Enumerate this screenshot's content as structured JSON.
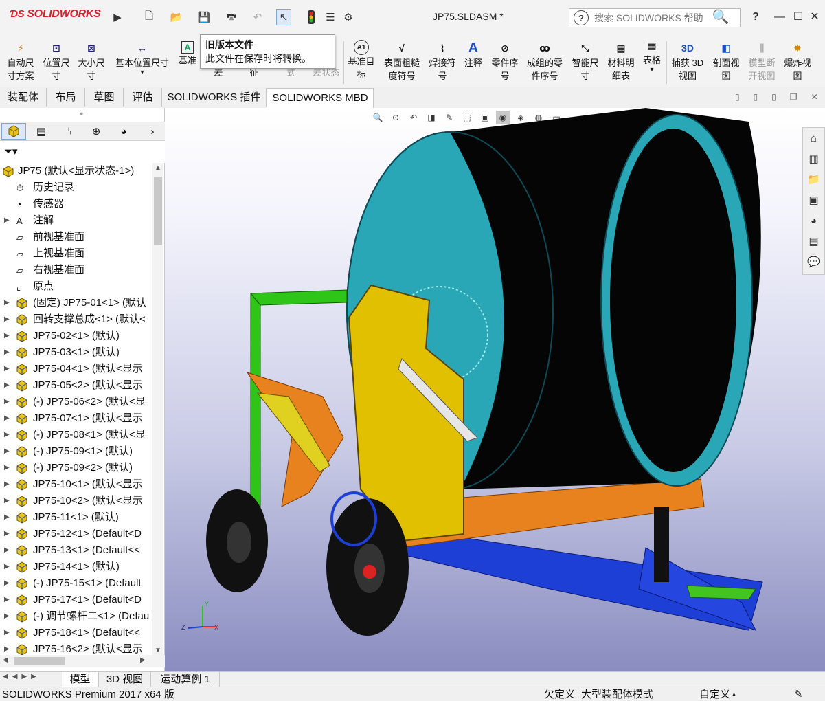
{
  "app": {
    "logo": "SOLIDWORKS",
    "document_title": "JP75.SLDASM *"
  },
  "search": {
    "placeholder": "搜索 SOLIDWORKS 帮助"
  },
  "tooltip": {
    "title": "旧版本文件",
    "text": "此文件在保存时将转换。"
  },
  "ribbon": {
    "items": [
      {
        "label": "自动尺\n寸方案"
      },
      {
        "label": "位置尺\n寸"
      },
      {
        "label": "大小尺\n寸"
      },
      {
        "label": "基本位置尺寸"
      },
      {
        "label": "基准"
      },
      {
        "label": "差"
      },
      {
        "label": "征"
      },
      {
        "label": "式"
      },
      {
        "label": "差状态"
      },
      {
        "label": "基准目\n标"
      },
      {
        "label": "表面粗糙\n度符号"
      },
      {
        "label": "焊接符\n号"
      },
      {
        "label": "注释"
      },
      {
        "label": "零件序\n号"
      },
      {
        "label": "成组的零\n件序号"
      },
      {
        "label": "智能尺\n寸"
      },
      {
        "label": "材料明\n细表"
      },
      {
        "label": "表格"
      },
      {
        "label": "捕获 3D\n视图"
      },
      {
        "label": "剖面视\n图"
      },
      {
        "label": "模型断\n开视图"
      },
      {
        "label": "爆炸视\n图"
      }
    ]
  },
  "command_tabs": [
    "装配体",
    "布局",
    "草图",
    "评估",
    "SOLIDWORKS 插件",
    "SOLIDWORKS MBD"
  ],
  "tree": {
    "root": "JP75  (默认<显示状态-1>)",
    "items": [
      {
        "label": "历史记录"
      },
      {
        "label": "传感器"
      },
      {
        "label": "注解"
      },
      {
        "label": "前视基准面"
      },
      {
        "label": "上视基准面"
      },
      {
        "label": "右视基准面"
      },
      {
        "label": "原点"
      },
      {
        "label": "(固定) JP75-01<1> (默认"
      },
      {
        "label": "回转支撑总成<1> (默认<"
      },
      {
        "label": "JP75-02<1> (默认)"
      },
      {
        "label": "JP75-03<1> (默认)"
      },
      {
        "label": "JP75-04<1> (默认<显示"
      },
      {
        "label": "JP75-05<2> (默认<显示"
      },
      {
        "label": "(-) JP75-06<2> (默认<显"
      },
      {
        "label": "JP75-07<1> (默认<显示"
      },
      {
        "label": "(-) JP75-08<1> (默认<显"
      },
      {
        "label": "(-) JP75-09<1> (默认)"
      },
      {
        "label": "(-) JP75-09<2> (默认)"
      },
      {
        "label": "JP75-10<1> (默认<显示"
      },
      {
        "label": "JP75-10<2> (默认<显示"
      },
      {
        "label": "JP75-11<1> (默认)"
      },
      {
        "label": "JP75-12<1> (Default<D"
      },
      {
        "label": "JP75-13<1> (Default<<"
      },
      {
        "label": "JP75-14<1> (默认)"
      },
      {
        "label": "(-) JP75-15<1> (Default"
      },
      {
        "label": "JP75-17<1> (Default<D"
      },
      {
        "label": "(-) 调节螺杆二<1> (Defau"
      },
      {
        "label": "JP75-18<1> (Default<<"
      },
      {
        "label": "JP75-16<2> (默认<显示"
      }
    ]
  },
  "bottom_tabs": [
    "模型",
    "3D 视图",
    "运动算例 1"
  ],
  "status": {
    "product": "SOLIDWORKS Premium 2017 x64 版",
    "underdefined": "欠定义",
    "mode": "大型装配体模式",
    "custom": "自定义"
  },
  "triad": {
    "x": "X",
    "y": "Y",
    "z": "Z"
  },
  "colors": {
    "brand_red": "#d6202c",
    "reel_teal": "#2aa7b6",
    "frame_orange": "#e8821e",
    "chassis_blue": "#1d3fd6",
    "bracket_yellow": "#e0c000",
    "frame_green": "#2ec418",
    "viewport_top": "#ffffff",
    "viewport_bottom": "#8a8cc0"
  }
}
